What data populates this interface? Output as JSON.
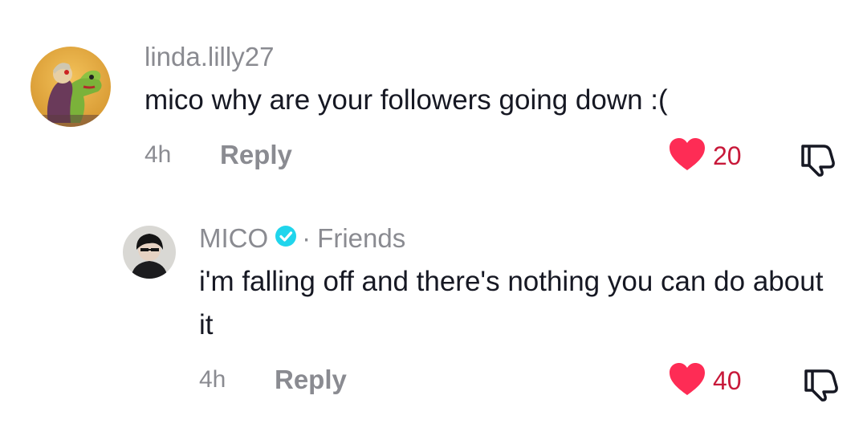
{
  "comments": [
    {
      "username": "linda.lilly27",
      "text": "mico why are your followers going down :(",
      "time": "4h",
      "reply_label": "Reply",
      "likes": "20",
      "liked": true
    },
    {
      "username": "MICO",
      "verified": true,
      "relation": "Friends",
      "separator": "·",
      "text": "i'm falling off and there's nothing you can do about it",
      "time": "4h",
      "reply_label": "Reply",
      "likes": "40",
      "liked": true
    }
  ],
  "colors": {
    "heart": "#fe2c55",
    "like_count": "#c8193a",
    "muted_text": "#8a8b91",
    "verified_badge": "#20d5ec"
  },
  "icons": {
    "like": "heart-icon",
    "dislike": "thumbs-down-icon",
    "verified": "verified-badge-icon"
  }
}
